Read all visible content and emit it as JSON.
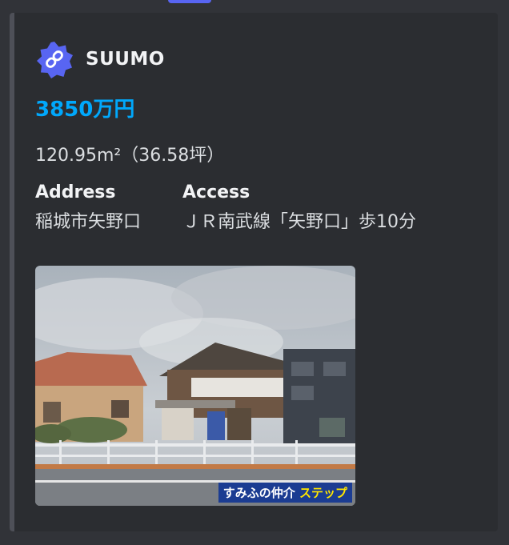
{
  "embed": {
    "author": {
      "name": "SUUMO",
      "icon": "link-badge-icon",
      "icon_color": "#5865f2"
    },
    "price": "3850万円",
    "price_color": "#00a8fc",
    "size": "120.95m²（36.58坪）",
    "fields": [
      {
        "name": "Address",
        "value": "稲城市矢野口"
      },
      {
        "name": "Access",
        "value": "ＪＲ南武線「矢野口」歩10分"
      }
    ],
    "image": {
      "watermark_primary": "すみふの仲介",
      "watermark_accent": "ステップ"
    },
    "accent_bar_color": "#4e5058"
  }
}
